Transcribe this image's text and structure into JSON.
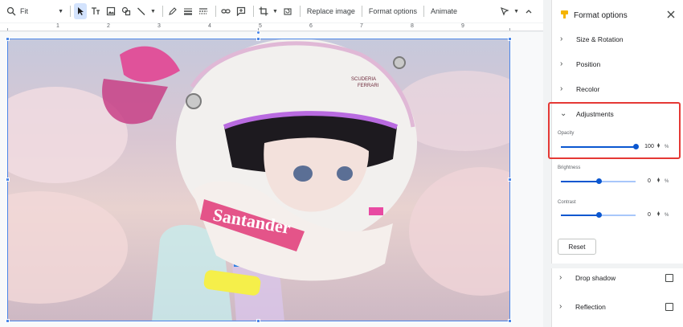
{
  "toolbar": {
    "zoom_label": "Fit",
    "replace_image": "Replace image",
    "format_options": "Format options",
    "animate": "Animate"
  },
  "ruler": {
    "numbers": [
      "1",
      "2",
      "3",
      "4",
      "5",
      "6",
      "7",
      "8",
      "9"
    ]
  },
  "image_text": {
    "brand": "Santander",
    "small_logo_line1": "SCUDERIA",
    "small_logo_line2": "FERRARI"
  },
  "panel": {
    "title": "Format options",
    "sections": {
      "size_rotation": "Size & Rotation",
      "position": "Position",
      "recolor": "Recolor",
      "adjustments": "Adjustments",
      "drop_shadow": "Drop shadow",
      "reflection": "Reflection"
    },
    "adjustments": {
      "opacity": {
        "label": "Opacity",
        "value": "100",
        "unit": "%",
        "level": 1.0
      },
      "brightness": {
        "label": "Brightness",
        "value": "0",
        "unit": "%",
        "level": 0.5
      },
      "contrast": {
        "label": "Contrast",
        "value": "0",
        "unit": "%",
        "level": 0.5
      }
    },
    "reset": "Reset"
  },
  "colors": {
    "accent": "#0b57d0",
    "highlight": "#e53935",
    "selection": "#4a86e8"
  }
}
